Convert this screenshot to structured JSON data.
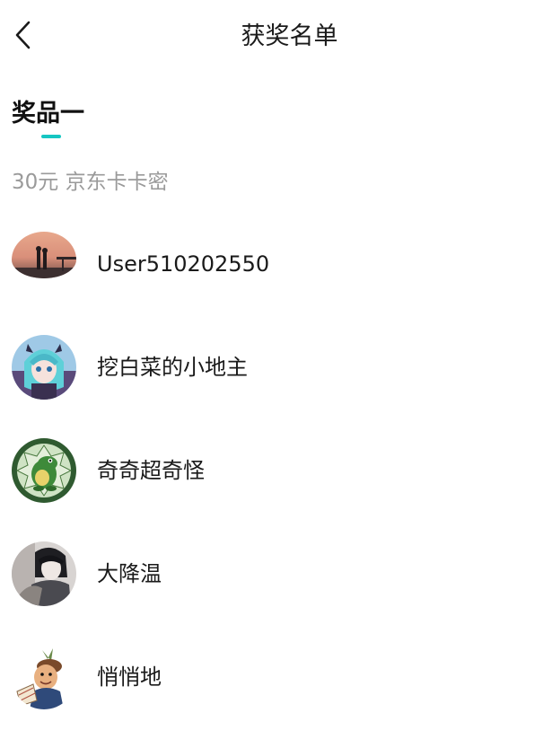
{
  "header": {
    "title": "获奖名单"
  },
  "prize": {
    "tab_label": "奖品一",
    "description": "30元 京东卡卡密"
  },
  "winners": [
    {
      "name": "User510202550"
    },
    {
      "name": "挖白菜的小地主"
    },
    {
      "name": "奇奇超奇怪"
    },
    {
      "name": "大降温"
    },
    {
      "name": "悄悄地"
    }
  ],
  "colors": {
    "accent": "#16c6c2",
    "title_text": "#1a1a1a",
    "muted_text": "#9a9a9a"
  }
}
